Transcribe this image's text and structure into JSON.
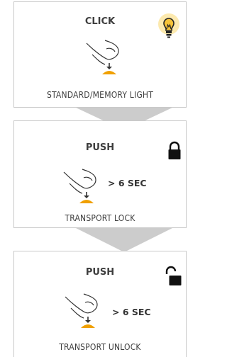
{
  "steps": [
    {
      "action": "CLICK",
      "duration": "",
      "result": "STANDARD/MEMORY LIGHT",
      "icon": "light-bulb-icon"
    },
    {
      "action": "PUSH",
      "duration": "> 6 SEC",
      "result": "TRANSPORT LOCK",
      "icon": "padlock-closed-icon"
    },
    {
      "action": "PUSH",
      "duration": "> 6 SEC",
      "result": "TRANSPORT UNLOCK",
      "icon": "padlock-open-icon"
    }
  ],
  "colors": {
    "border": "#c9c9c9",
    "arrow": "#cccccc",
    "button": "#f0a000",
    "bulb": "#f7c338",
    "text": "#3d3d3d"
  }
}
